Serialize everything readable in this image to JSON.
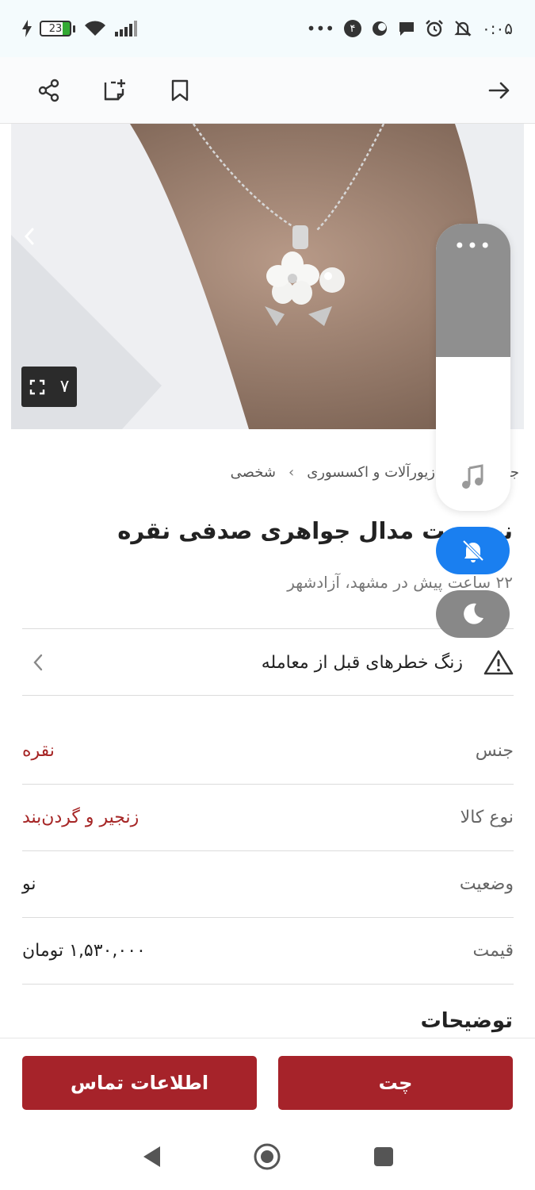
{
  "status_bar": {
    "battery": "23",
    "time": "۰:۰۵",
    "notification_count": "۴"
  },
  "gallery": {
    "photo_count": "۷"
  },
  "breadcrumb": [
    "جواهرات",
    "زیورآلات و اکسسوری",
    "شخصی"
  ],
  "listing": {
    "title": "نیم ست مدال جواهری صدفی نقره",
    "meta": "۲۲ ساعت پیش در مشهد، آزادشهر"
  },
  "risk": {
    "label": "زنگ خطرهای قبل از معامله"
  },
  "attributes": [
    {
      "key": "جنس",
      "value": "نقره",
      "link": true
    },
    {
      "key": "نوع کالا",
      "value": "زنجیر و گردن‌بند",
      "link": true
    },
    {
      "key": "وضعیت",
      "value": "نو",
      "link": false
    },
    {
      "key": "قیمت",
      "value": "۱,۵۳۰,۰۰۰ تومان",
      "link": false
    }
  ],
  "description": {
    "heading": "توضیحات"
  },
  "actions": {
    "chat": "چت",
    "contact": "اطلاعات تماس"
  },
  "overlay": {
    "menu": "•••"
  },
  "colors": {
    "brand": "#a6232a",
    "accent_blue": "#1a7ff0"
  }
}
